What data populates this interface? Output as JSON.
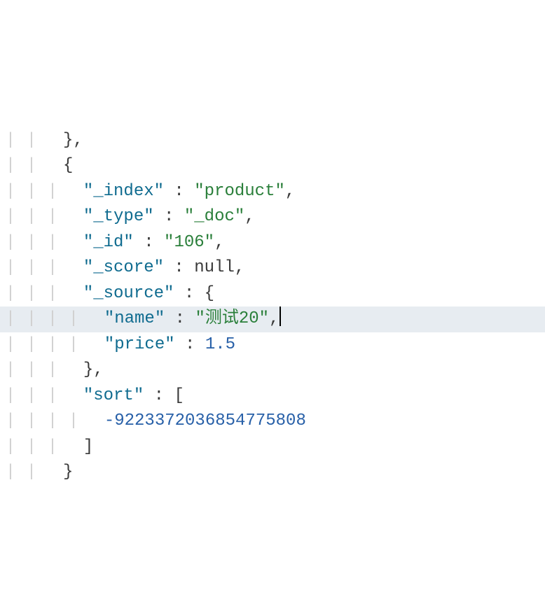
{
  "lines": [
    {
      "guides": [
        "|",
        "|",
        " "
      ],
      "tokens": [
        {
          "type": "punct",
          "text": "},"
        }
      ],
      "highlighted": false,
      "indent": 0
    },
    {
      "guides": [
        "|",
        "|",
        " "
      ],
      "tokens": [
        {
          "type": "punct",
          "text": "{"
        }
      ],
      "highlighted": false,
      "indent": 0
    },
    {
      "guides": [
        "|",
        "|",
        "|"
      ],
      "tokens": [
        {
          "type": "key",
          "text": "\"_index\""
        },
        {
          "type": "punct",
          "text": " : "
        },
        {
          "type": "string",
          "text": "\"product\""
        },
        {
          "type": "punct",
          "text": ","
        }
      ],
      "highlighted": false,
      "indent": 1
    },
    {
      "guides": [
        "|",
        "|",
        "|"
      ],
      "tokens": [
        {
          "type": "key",
          "text": "\"_type\""
        },
        {
          "type": "punct",
          "text": " : "
        },
        {
          "type": "string",
          "text": "\"_doc\""
        },
        {
          "type": "punct",
          "text": ","
        }
      ],
      "highlighted": false,
      "indent": 1
    },
    {
      "guides": [
        "|",
        "|",
        "|"
      ],
      "tokens": [
        {
          "type": "key",
          "text": "\"_id\""
        },
        {
          "type": "punct",
          "text": " : "
        },
        {
          "type": "string",
          "text": "\"106\""
        },
        {
          "type": "punct",
          "text": ","
        }
      ],
      "highlighted": false,
      "indent": 1
    },
    {
      "guides": [
        "|",
        "|",
        "|"
      ],
      "tokens": [
        {
          "type": "key",
          "text": "\"_score\""
        },
        {
          "type": "punct",
          "text": " : "
        },
        {
          "type": "null",
          "text": "null"
        },
        {
          "type": "punct",
          "text": ","
        }
      ],
      "highlighted": false,
      "indent": 1
    },
    {
      "guides": [
        "|",
        "|",
        "|"
      ],
      "tokens": [
        {
          "type": "key",
          "text": "\"_source\""
        },
        {
          "type": "punct",
          "text": " : {"
        }
      ],
      "highlighted": false,
      "indent": 1
    },
    {
      "guides": [
        "|",
        "|",
        "|",
        "|"
      ],
      "tokens": [
        {
          "type": "key",
          "text": "\"name\""
        },
        {
          "type": "punct",
          "text": " : "
        },
        {
          "type": "string",
          "text": "\"测试20\""
        },
        {
          "type": "punct",
          "text": ","
        }
      ],
      "highlighted": true,
      "indent": 1,
      "cursor": true
    },
    {
      "guides": [
        "|",
        "|",
        "|",
        "|"
      ],
      "tokens": [
        {
          "type": "key",
          "text": "\"price\""
        },
        {
          "type": "punct",
          "text": " : "
        },
        {
          "type": "number",
          "text": "1.5"
        }
      ],
      "highlighted": false,
      "indent": 1
    },
    {
      "guides": [
        "|",
        "|",
        "|"
      ],
      "tokens": [
        {
          "type": "punct",
          "text": "},"
        }
      ],
      "highlighted": false,
      "indent": 1
    },
    {
      "guides": [
        "|",
        "|",
        "|"
      ],
      "tokens": [
        {
          "type": "key",
          "text": "\"sort\""
        },
        {
          "type": "punct",
          "text": " : ["
        }
      ],
      "highlighted": false,
      "indent": 1
    },
    {
      "guides": [
        "|",
        "|",
        "|",
        "|"
      ],
      "tokens": [
        {
          "type": "number",
          "text": "-9223372036854775808"
        }
      ],
      "highlighted": false,
      "indent": 1
    },
    {
      "guides": [
        "|",
        "|",
        "|"
      ],
      "tokens": [
        {
          "type": "punct",
          "text": "]"
        }
      ],
      "highlighted": false,
      "indent": 1
    },
    {
      "guides": [
        "|",
        "|",
        " "
      ],
      "tokens": [
        {
          "type": "punct",
          "text": "}"
        }
      ],
      "highlighted": false,
      "indent": 0
    }
  ]
}
